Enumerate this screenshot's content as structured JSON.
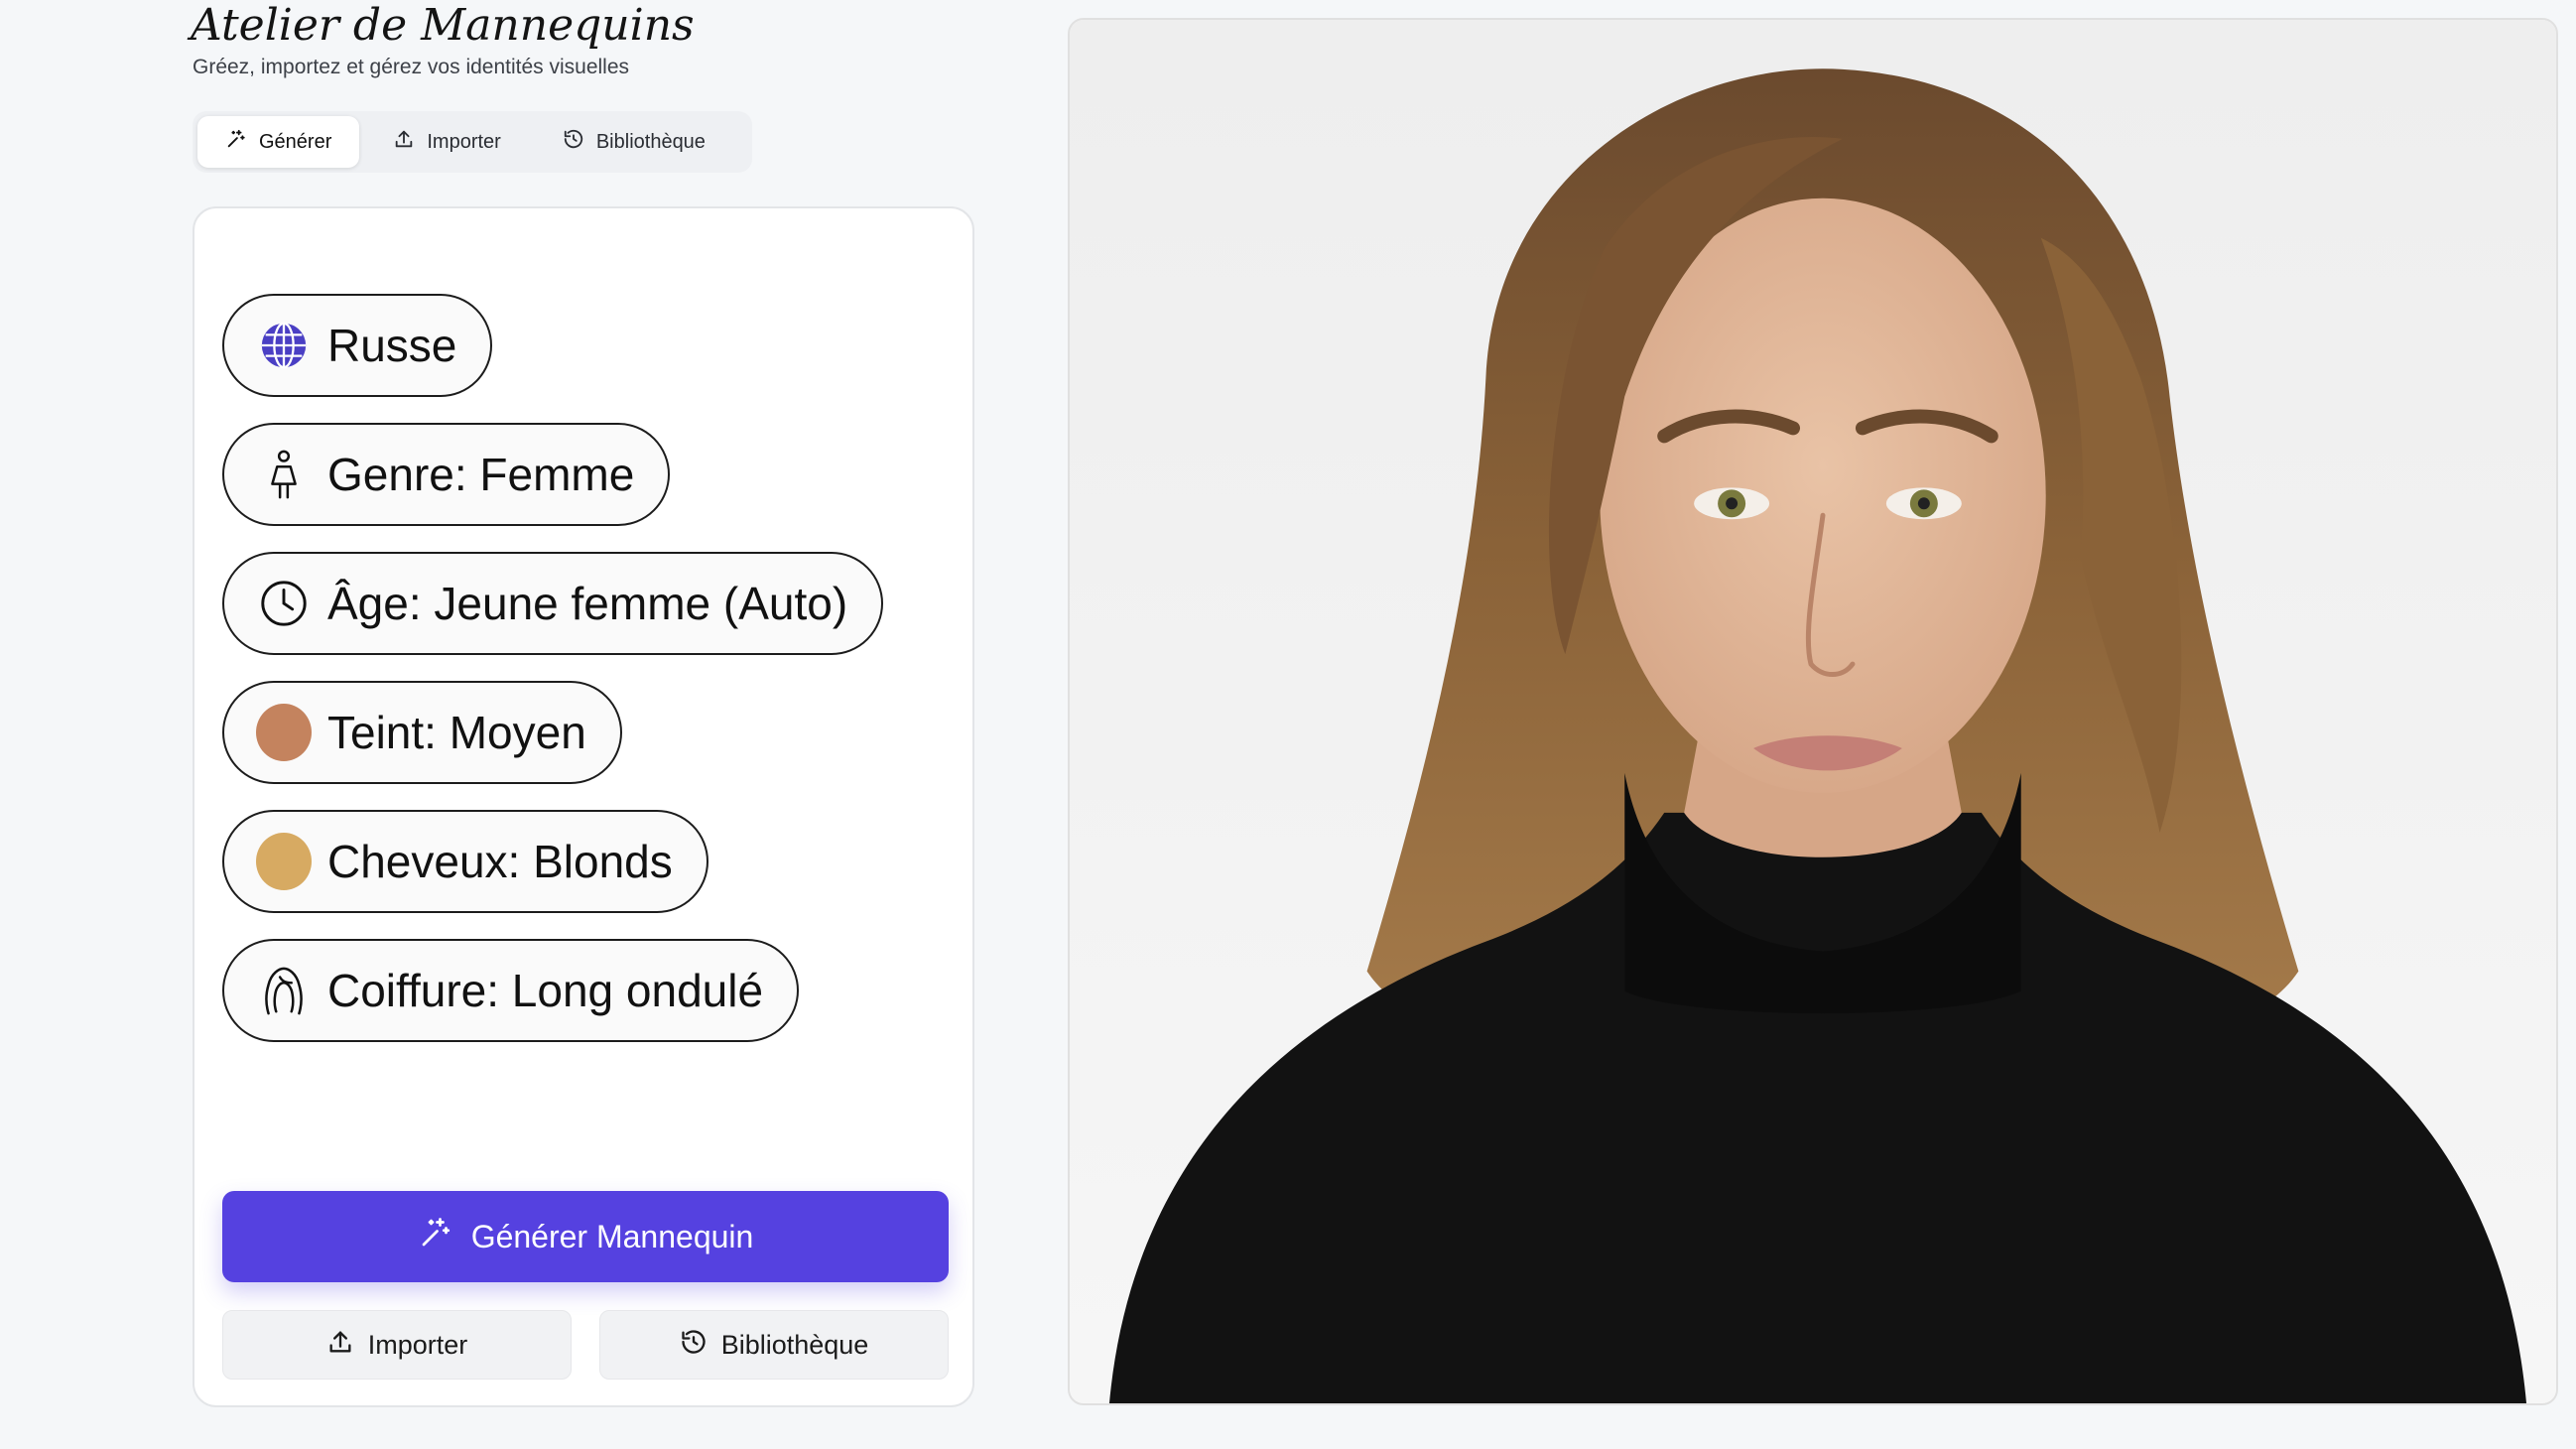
{
  "app": {
    "title": "Atelier de Mannequins",
    "subtitle": "Gréez, importez et gérez vos identités visuelles"
  },
  "tabs": [
    {
      "label": "Générer",
      "icon": "sparkle-icon",
      "active": true
    },
    {
      "label": "Importer",
      "icon": "upload-icon",
      "active": false
    },
    {
      "label": "Bibliothèque",
      "icon": "history-icon",
      "active": false
    }
  ],
  "attributes": [
    {
      "label": "Russe",
      "icon": "globe-icon"
    },
    {
      "label": "Genre: Femme",
      "icon": "woman-icon"
    },
    {
      "label": "Âge: Jeune femme (Auto)",
      "icon": "clock-icon"
    },
    {
      "label": "Teint: Moyen",
      "icon": "skin-swatch-icon",
      "color": "#c4835e"
    },
    {
      "label": "Cheveux: Blonds",
      "icon": "hair-swatch-icon",
      "color": "#d7aa62"
    },
    {
      "label": "Coiffure: Long ondulé",
      "icon": "hairstyle-icon"
    }
  ],
  "actions": {
    "generate_label": "Générer Mannequin",
    "import_label": "Importer",
    "library_label": "Bibliothèque"
  },
  "colors": {
    "accent": "#5541e0",
    "globe": "#4a3fc4"
  },
  "preview": {
    "icon": "generated-model-portrait-image"
  }
}
